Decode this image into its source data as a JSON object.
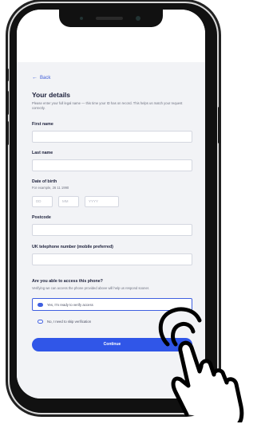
{
  "nav": {
    "back_label": "Back"
  },
  "page": {
    "title": "Your details",
    "intro": "Please enter your full legal name — this time your ID has on record. This helps us match your request correctly."
  },
  "form": {
    "first_name_label": "First name",
    "last_name_label": "Last name",
    "dob_label": "Date of birth",
    "dob_hint": "For example, 26 11 1990",
    "dob_day_placeholder": "DD",
    "dob_month_placeholder": "MM",
    "dob_year_placeholder": "YYYY",
    "postcode_label": "Postcode",
    "phone_label": "UK telephone number (mobile preferred)"
  },
  "verification": {
    "question": "Are you able to access this phone?",
    "description": "Verifying we can access the phone provided above will help us respond sooner.",
    "options": [
      {
        "label": "Yes, I'm ready to verify access",
        "selected": true
      },
      {
        "label": "No, I need to skip verification",
        "selected": false
      }
    ]
  },
  "actions": {
    "continue_label": "Continue"
  },
  "colors": {
    "accent": "#3056e8",
    "screen_bg": "#f2f3f6"
  },
  "decor": {
    "pointer": "hand-pointer-icon"
  }
}
